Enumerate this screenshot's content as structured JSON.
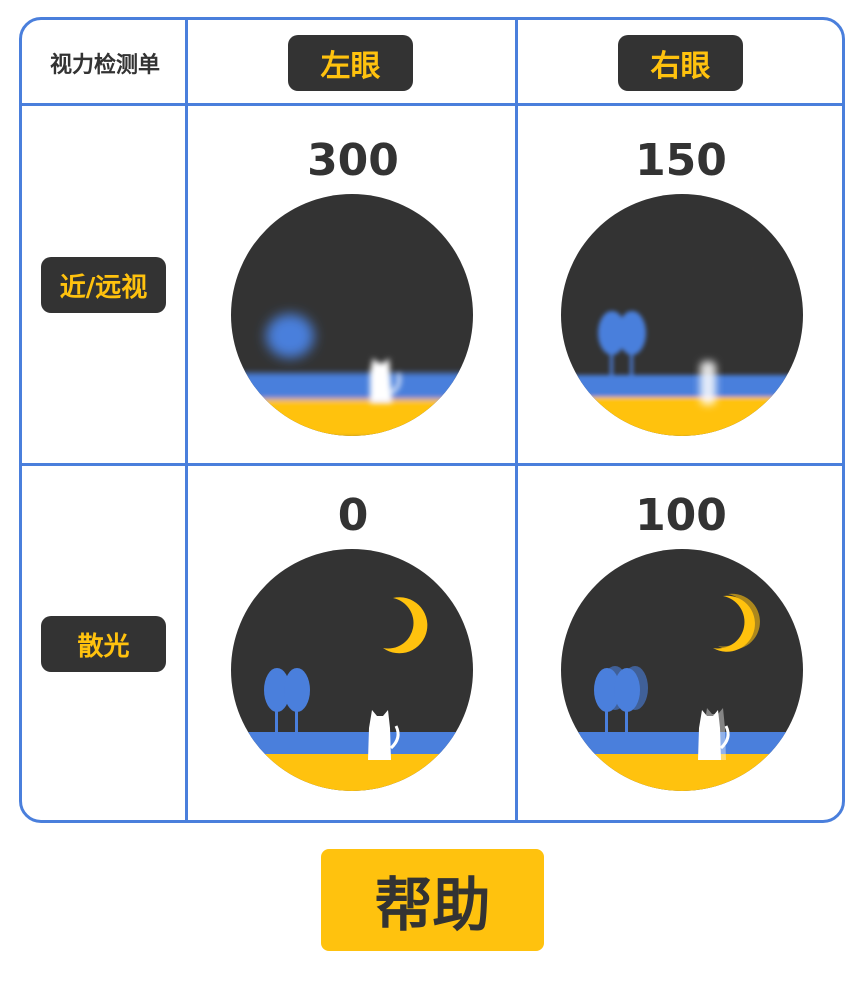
{
  "table": {
    "title": "视力检测单",
    "columns": [
      "左眼",
      "右眼"
    ],
    "rows": [
      {
        "label": "近/远视",
        "values": [
          "300",
          "150"
        ]
      },
      {
        "label": "散光",
        "values": [
          "0",
          "100"
        ]
      }
    ]
  },
  "help_label": "帮助",
  "colors": {
    "accent": "#ffc20e",
    "dark": "#333333",
    "border": "#4a7fdc",
    "water": "#4a7fdc"
  },
  "scenes": [
    {
      "name": "scene-left-myopia",
      "blur": "strong"
    },
    {
      "name": "scene-right-myopia",
      "blur": "medium"
    },
    {
      "name": "scene-left-astigmatism",
      "blur": "none"
    },
    {
      "name": "scene-right-astigmatism",
      "blur": "double"
    }
  ]
}
